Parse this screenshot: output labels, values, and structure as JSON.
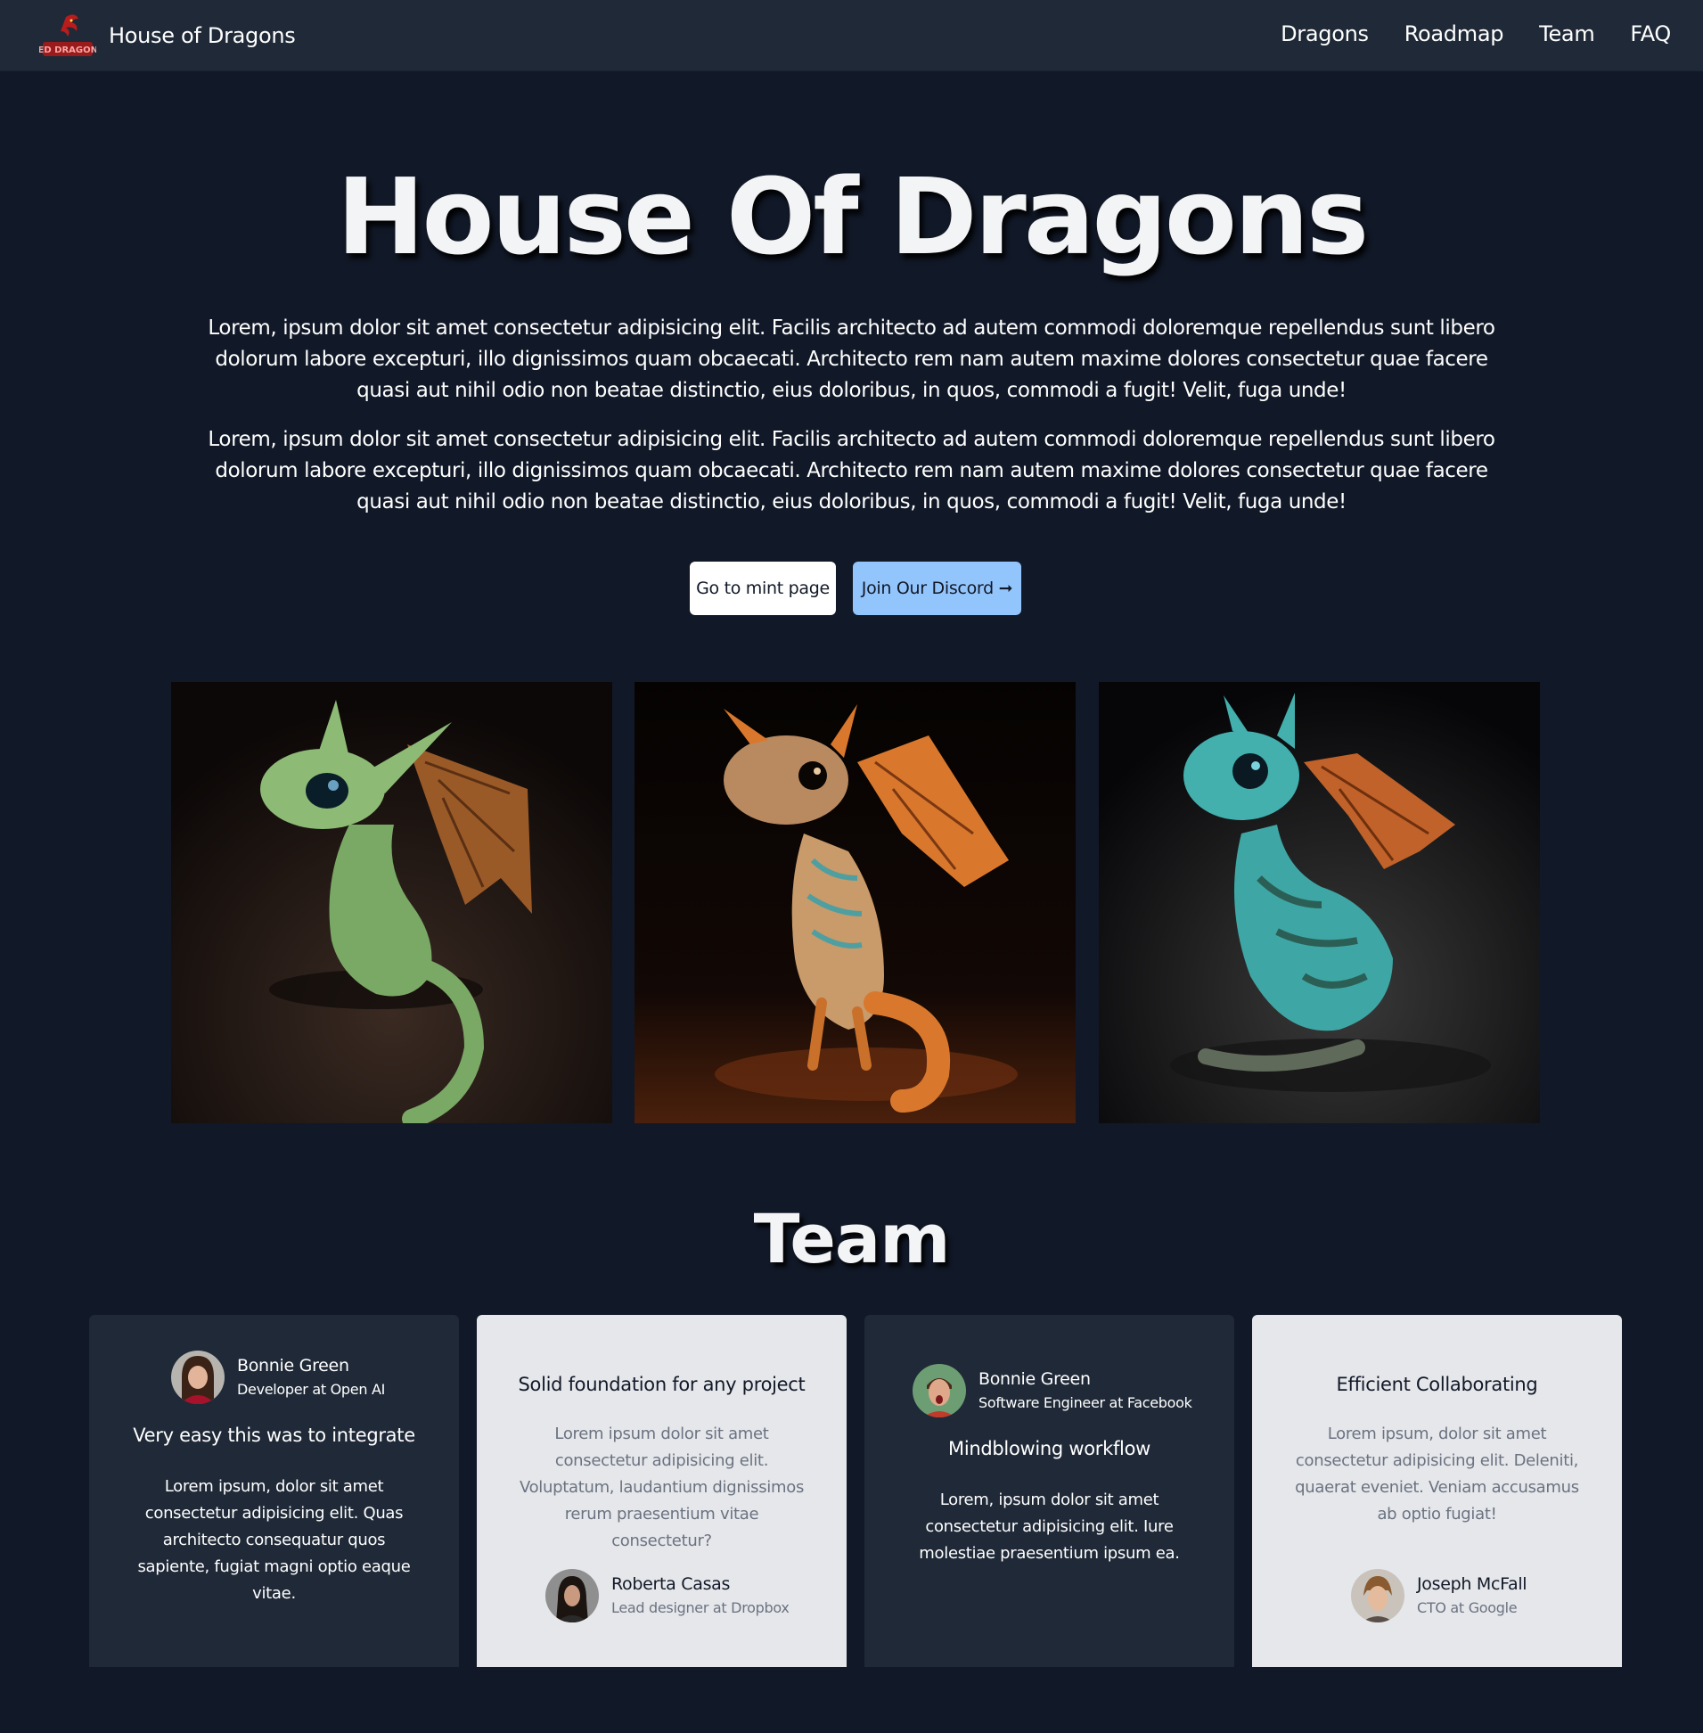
{
  "nav": {
    "brand": "House of Dragons",
    "links": [
      "Dragons",
      "Roadmap",
      "Team",
      "FAQ"
    ]
  },
  "hero": {
    "title": "House Of Dragons",
    "paragraph1": "Lorem, ipsum dolor sit amet consectetur adipisicing elit. Facilis architecto ad autem commodi doloremque repellendus sunt libero dolorum labore excepturi, illo dignissimos quam obcaecati. Architecto rem nam autem maxime dolores consectetur quae facere quasi aut nihil odio non beatae distinctio, eius doloribus, in quos, commodi a fugit! Velit, fuga unde!",
    "paragraph2": "Lorem, ipsum dolor sit amet consectetur adipisicing elit. Facilis architecto ad autem commodi doloremque repellendus sunt libero dolorum labore excepturi, illo dignissimos quam obcaecati. Architecto rem nam autem maxime dolores consectetur quae facere quasi aut nihil odio non beatae distinctio, eius doloribus, in quos, commodi a fugit! Velit, fuga unde!",
    "mint_label": "Go to mint page",
    "discord_label": "Join Our Discord ➞"
  },
  "gallery": {
    "images": [
      "green-dragon-image",
      "orange-dragon-image",
      "teal-dragon-image"
    ]
  },
  "team": {
    "title": "Team",
    "cards": [
      {
        "name": "Bonnie Green",
        "role": "Developer at Open AI",
        "quote_title": "Very easy this was to integrate",
        "quote": "Lorem ipsum, dolor sit amet consectetur adipisicing elit. Quas architecto consequatur quos sapiente, fugiat magni optio eaque vitae."
      },
      {
        "name": "Roberta Casas",
        "role": "Lead designer at Dropbox",
        "quote_title": "Solid foundation for any project",
        "quote": "Lorem ipsum dolor sit amet consectetur adipisicing elit. Voluptatum, laudantium dignissimos rerum praesentium vitae consectetur?"
      },
      {
        "name": "Bonnie Green",
        "role": "Software Engineer at Facebook",
        "quote_title": "Mindblowing workflow",
        "quote": "Lorem, ipsum dolor sit amet consectetur adipisicing elit. Iure molestiae praesentium ipsum ea."
      },
      {
        "name": "Joseph McFall",
        "role": "CTO at Google",
        "quote_title": "Efficient Collaborating",
        "quote": "Lorem ipsum, dolor sit amet consectetur adipisicing elit. Deleniti, quaerat eveniet. Veniam accusamus ab optio fugiat!"
      }
    ]
  },
  "colors": {
    "page_bg": "#111827",
    "nav_bg": "#1f2937",
    "discord_button": "#93c5fd",
    "light_card": "#e5e7eb"
  }
}
